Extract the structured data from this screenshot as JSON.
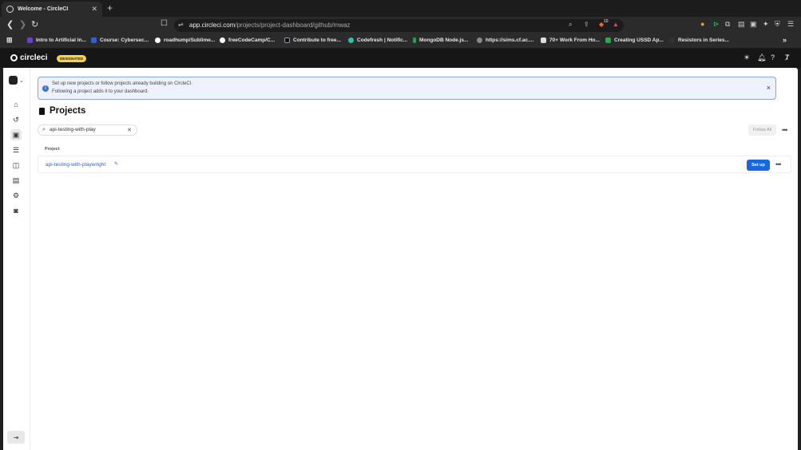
{
  "browser": {
    "tab_title": "Welcome - CircleCI",
    "tab_close": "✕",
    "new_tab": "+",
    "url_host": "app.circleci.com",
    "url_path": "/projects/project-dashboard/github/mwaz",
    "shield_count": "10",
    "bookmarks": [
      {
        "label": "Intro to Artificial In...",
        "icon": "ai-course-icon",
        "color": "#6c3fd1"
      },
      {
        "label": "Course: Cybersec...",
        "icon": "course-icon",
        "color": "#2e62d6"
      },
      {
        "label": "roadhump/Sublime...",
        "icon": "github-icon",
        "color": "#ffffff"
      },
      {
        "label": "freeCodeCamp/C...",
        "icon": "github-icon",
        "color": "#ffffff"
      },
      {
        "label": "Contribute to free...",
        "icon": "freecodecamp-icon",
        "color": "#0a0a23"
      },
      {
        "label": "Codefresh | Notific...",
        "icon": "codefresh-icon",
        "color": "#27c4a8"
      },
      {
        "label": "MongoDB Node.js...",
        "icon": "mongodb-icon",
        "color": "#13aa52"
      },
      {
        "label": "https://sims.cf.ac....",
        "icon": "globe-icon",
        "color": "#888888"
      },
      {
        "label": "70+ Work From Ho...",
        "icon": "page-icon",
        "color": "#dddddd"
      },
      {
        "label": "Creating USSD Ap...",
        "icon": "ussd-icon",
        "color": "#2da84a"
      },
      {
        "label": "Resistors in Series...",
        "icon": "circuit-icon",
        "color": "#333333"
      }
    ]
  },
  "header": {
    "logo": "circleci",
    "badge": "DESIGNATED"
  },
  "banner": {
    "line1": "Set up new projects or follow projects already building on CircleCI.",
    "line2": "Following a project adds it to your dashboard.",
    "close": "×"
  },
  "page": {
    "title": "Projects",
    "search_value": "api-testing-with-play",
    "follow_all": "Follow All",
    "column_header": "Project",
    "projects": [
      {
        "name": "api-testing-with-playwright",
        "action": "Set up"
      }
    ]
  },
  "colors": {
    "accent": "#1667e0",
    "banner_bg": "#eef2ff",
    "badge": "#f5d547"
  }
}
